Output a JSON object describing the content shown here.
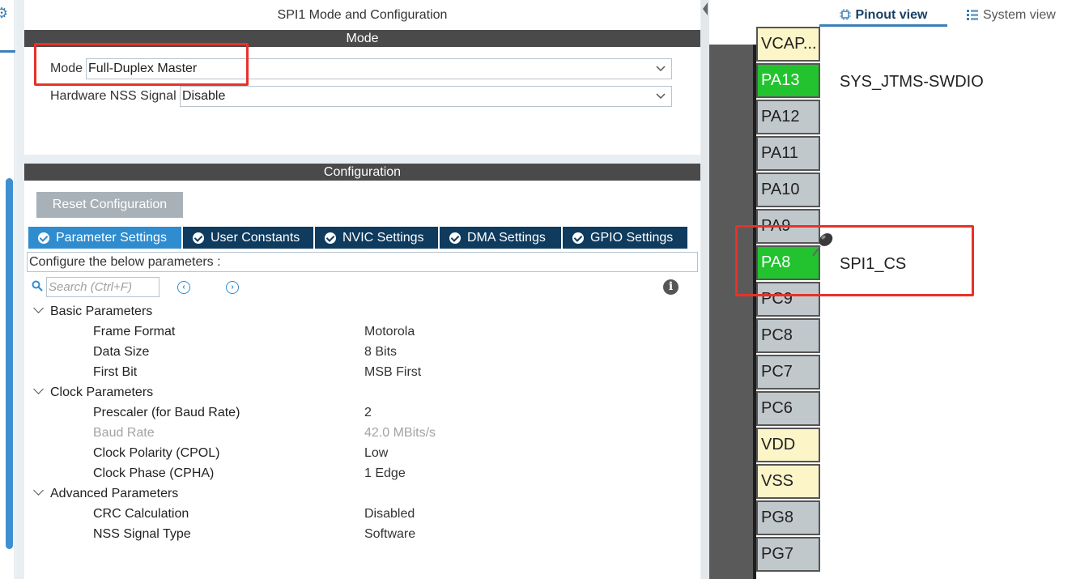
{
  "left_panel": {
    "title": "SPI1 Mode and Configuration",
    "mode_section": {
      "header": "Mode",
      "mode_label": "Mode",
      "mode_value": "Full-Duplex Master",
      "nss_label": "Hardware NSS Signal",
      "nss_value": "Disable"
    },
    "config_section": {
      "header": "Configuration",
      "reset_button": "Reset Configuration",
      "tabs": [
        {
          "label": "Parameter Settings",
          "active": true
        },
        {
          "label": "User Constants",
          "active": false
        },
        {
          "label": "NVIC Settings",
          "active": false
        },
        {
          "label": "DMA Settings",
          "active": false
        },
        {
          "label": "GPIO Settings",
          "active": false
        }
      ],
      "description": "Configure the below parameters :",
      "search_placeholder": "Search (Ctrl+F)",
      "groups": [
        {
          "name": "Basic Parameters",
          "params": [
            {
              "name": "Frame Format",
              "value": "Motorola",
              "disabled": false
            },
            {
              "name": "Data Size",
              "value": "8 Bits",
              "disabled": false
            },
            {
              "name": "First Bit",
              "value": "MSB First",
              "disabled": false
            }
          ]
        },
        {
          "name": "Clock Parameters",
          "params": [
            {
              "name": "Prescaler (for Baud Rate)",
              "value": "2",
              "disabled": false
            },
            {
              "name": "Baud Rate",
              "value": "42.0 MBits/s",
              "disabled": true
            },
            {
              "name": "Clock Polarity (CPOL)",
              "value": "Low",
              "disabled": false
            },
            {
              "name": "Clock Phase (CPHA)",
              "value": "1 Edge",
              "disabled": false
            }
          ]
        },
        {
          "name": "Advanced Parameters",
          "params": [
            {
              "name": "CRC Calculation",
              "value": "Disabled",
              "disabled": false
            },
            {
              "name": "NSS Signal Type",
              "value": "Software",
              "disabled": false
            }
          ]
        }
      ]
    }
  },
  "right_panel": {
    "pinout_tab": "Pinout view",
    "system_tab": "System view",
    "pins": [
      {
        "name": "VCAP...",
        "state": "yellow"
      },
      {
        "name": "PA13",
        "state": "green",
        "signal": "SYS_JTMS-SWDIO"
      },
      {
        "name": "PA12",
        "state": "gray"
      },
      {
        "name": "PA11",
        "state": "gray"
      },
      {
        "name": "PA10",
        "state": "gray"
      },
      {
        "name": "PA9",
        "state": "gray"
      },
      {
        "name": "PA8",
        "state": "green",
        "signal": "SPI1_CS"
      },
      {
        "name": "PC9",
        "state": "gray"
      },
      {
        "name": "PC8",
        "state": "gray"
      },
      {
        "name": "PC7",
        "state": "gray"
      },
      {
        "name": "PC6",
        "state": "gray"
      },
      {
        "name": "VDD",
        "state": "yellow"
      },
      {
        "name": "VSS",
        "state": "yellow"
      },
      {
        "name": "PG8",
        "state": "gray"
      },
      {
        "name": "PG7",
        "state": "gray"
      }
    ]
  },
  "colors": {
    "accent": "#2f8ccf",
    "tab_dark": "#0f3b5f",
    "pin_green": "#22c32e",
    "pin_yellow": "#fbf5c8",
    "highlight_red": "#e8312a"
  }
}
